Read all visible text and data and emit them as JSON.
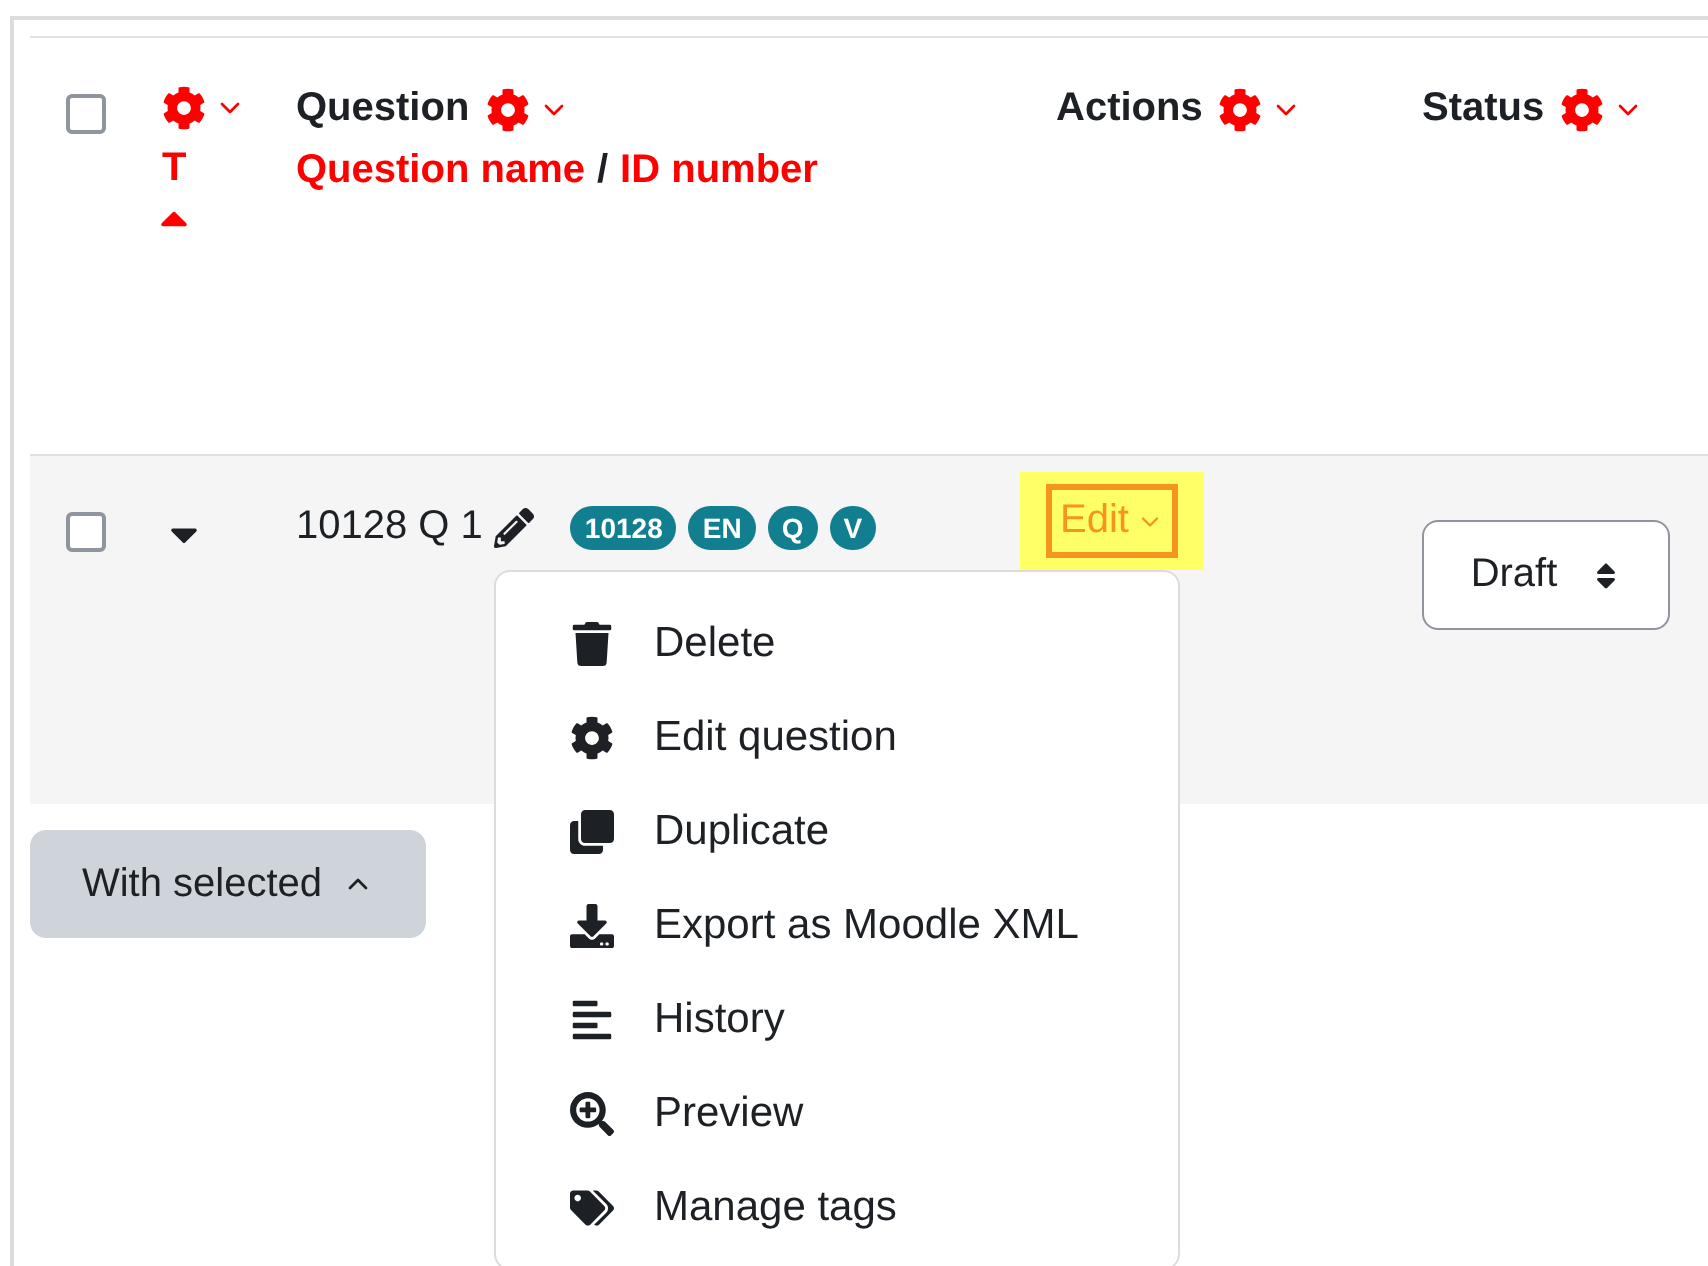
{
  "table": {
    "select_all": {
      "checked": false
    },
    "columns": [
      {
        "sort_links": [
          {
            "text": "T"
          }
        ],
        "sorted": true
      },
      {
        "label": "Question",
        "sort_links": [
          {
            "text": "Question name"
          },
          {
            "text": "ID number"
          }
        ],
        "separator": "/",
        "sorted": false
      },
      {
        "label": "Actions",
        "sorted": false
      },
      {
        "label": "Status",
        "sorted": false
      }
    ],
    "rows": [
      {
        "checked": false,
        "expanded": true,
        "name": "10128 Q 1",
        "badges": [
          "10128",
          "EN",
          "Q",
          "V"
        ],
        "action": "Edit",
        "status": "Draft"
      }
    ]
  },
  "action_menu": {
    "items": [
      {
        "label": "Delete"
      },
      {
        "label": "Edit question"
      },
      {
        "label": "Duplicate"
      },
      {
        "label": "Export as Moodle XML"
      },
      {
        "label": "History"
      },
      {
        "label": "Preview"
      },
      {
        "label": "Manage tags"
      }
    ]
  },
  "bulk_button": {
    "label": "With selected",
    "expanded": false
  }
}
